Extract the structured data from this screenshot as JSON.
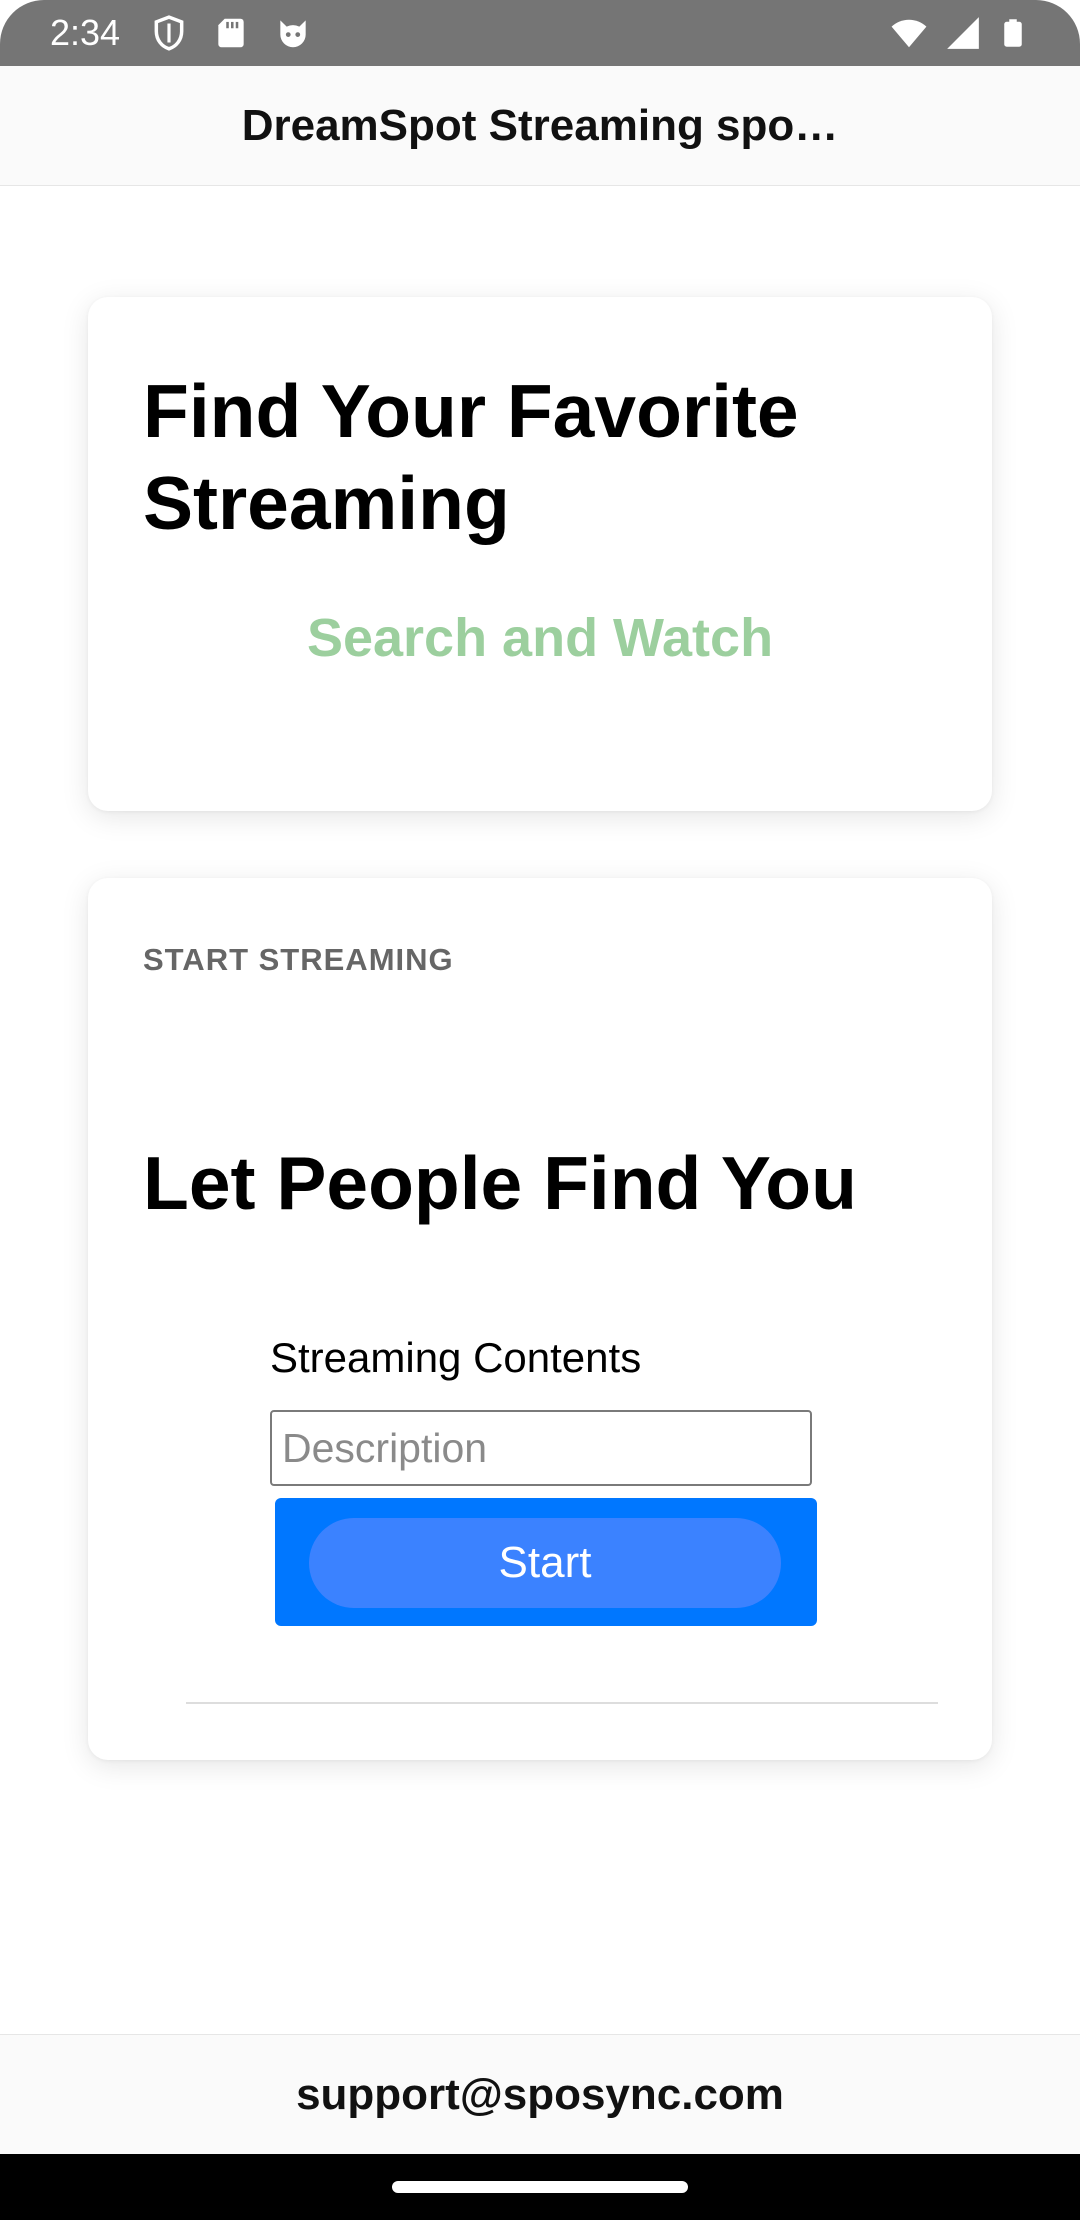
{
  "status_bar": {
    "time": "2:34",
    "left_icons": [
      "shield-icon",
      "sd-card-icon",
      "cat-face-icon"
    ],
    "right_icons": [
      "wifi-icon",
      "cellular-signal-icon",
      "battery-icon"
    ]
  },
  "app_bar": {
    "title": "DreamSpot Streaming spo…"
  },
  "hero_card": {
    "title": "Find Your Favorite Streaming",
    "link": "Search and Watch",
    "link_color": "#9ccf9e"
  },
  "stream_card": {
    "section_label": "START STREAMING",
    "title": "Let People Find You",
    "field_label": "Streaming Contents",
    "input": {
      "value": "",
      "placeholder": "Description"
    },
    "start_button_label": "Start",
    "accent_color": "#0077ff"
  },
  "footer": {
    "email": "support@sposync.com"
  }
}
